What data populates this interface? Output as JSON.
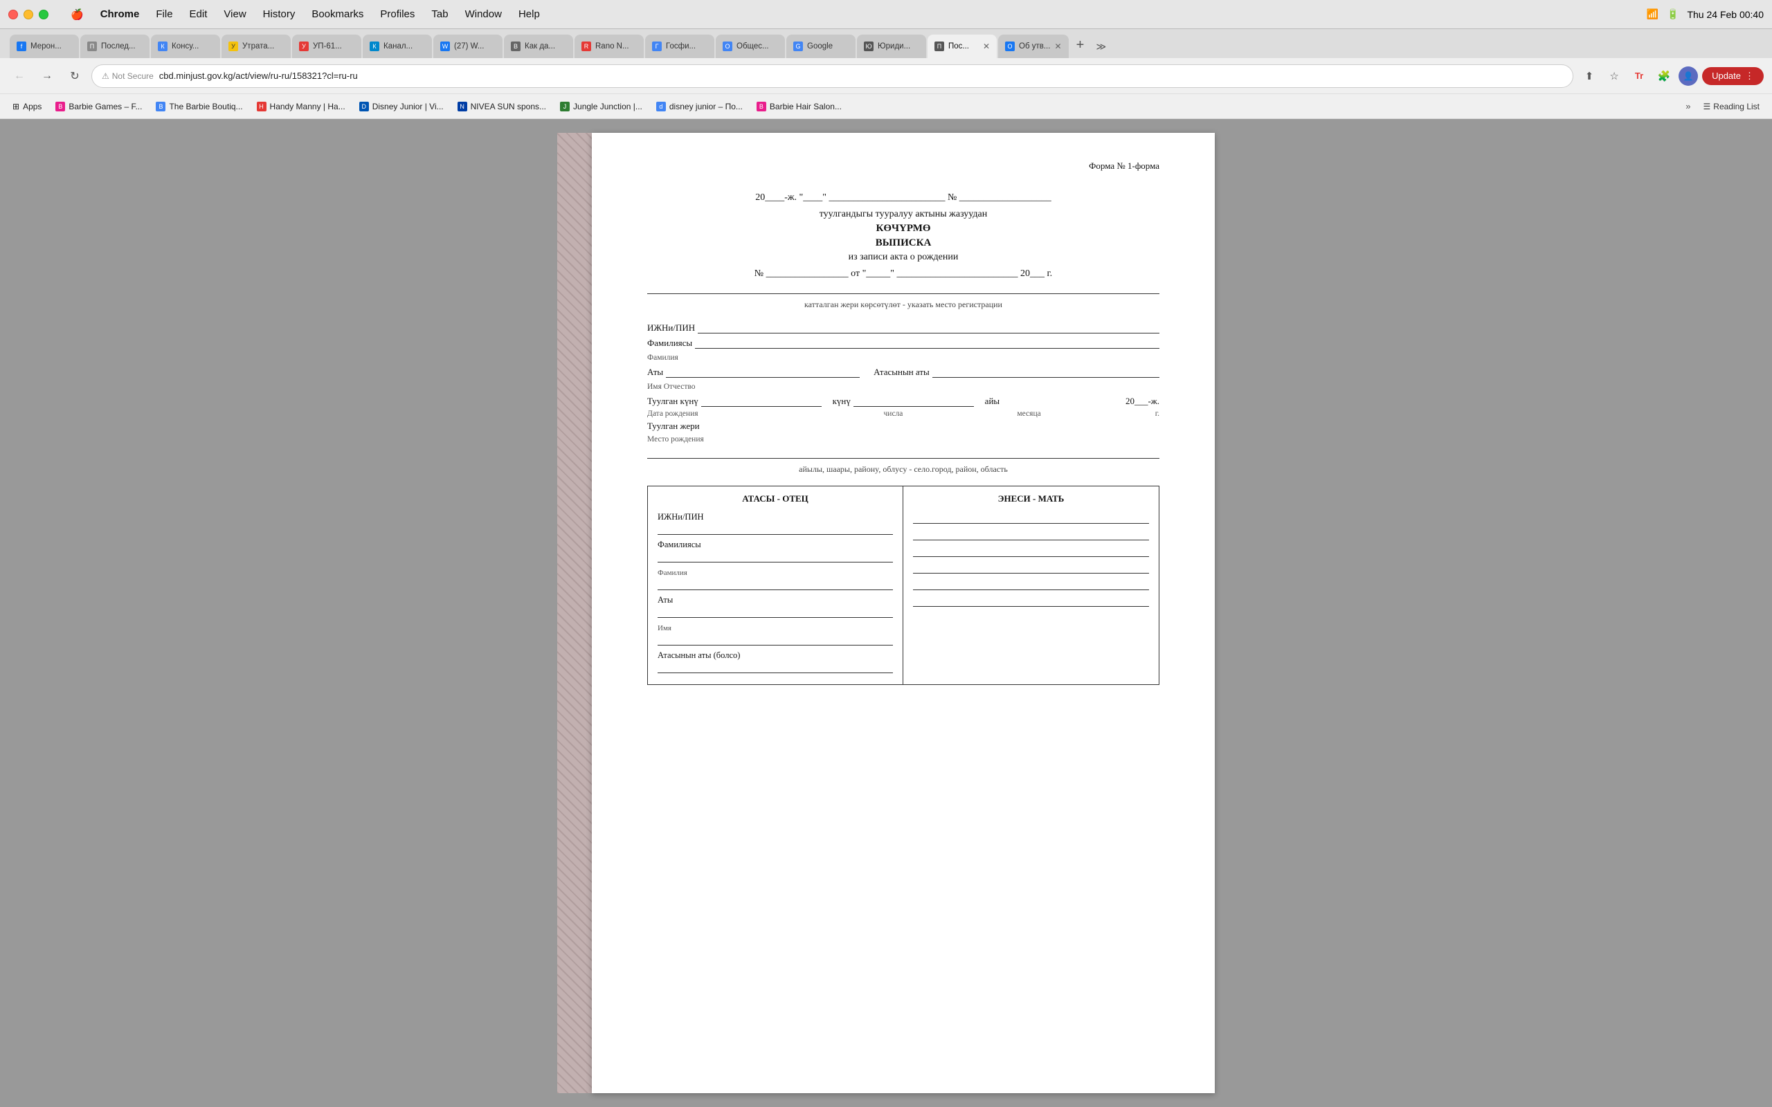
{
  "menubar": {
    "apple": "🍎",
    "items": [
      "Chrome",
      "File",
      "Edit",
      "View",
      "History",
      "Bookmarks",
      "Profiles",
      "Tab",
      "Window",
      "Help"
    ],
    "active_item": "Chrome",
    "time": "Thu 24 Feb  00:40"
  },
  "browser": {
    "tabs": [
      {
        "id": "t1",
        "label": "Мерон...",
        "favicon_color": "#1877f2",
        "favicon_letter": "f",
        "active": false
      },
      {
        "id": "t2",
        "label": "Послед...",
        "favicon_color": "#888",
        "favicon_letter": "П",
        "active": false
      },
      {
        "id": "t3",
        "label": "Консу...",
        "favicon_color": "#4285f4",
        "favicon_letter": "К",
        "active": false
      },
      {
        "id": "t4",
        "label": "Утрата...",
        "favicon_color": "#f4c20d",
        "favicon_letter": "У",
        "active": false
      },
      {
        "id": "t5",
        "label": "УП-61...",
        "favicon_color": "#e53935",
        "favicon_letter": "У",
        "active": false
      },
      {
        "id": "t6",
        "label": "Канал...",
        "favicon_color": "#0088cc",
        "favicon_letter": "К",
        "active": false
      },
      {
        "id": "t7",
        "label": "(27) W...",
        "favicon_color": "#1877f2",
        "favicon_letter": "W",
        "active": false
      },
      {
        "id": "t8",
        "label": "Как да...",
        "favicon_color": "#666",
        "favicon_letter": "B",
        "active": false
      },
      {
        "id": "t9",
        "label": "Rano N...",
        "favicon_color": "#e53935",
        "favicon_letter": "R",
        "active": false
      },
      {
        "id": "t10",
        "label": "Госфи...",
        "favicon_color": "#4285f4",
        "favicon_letter": "Г",
        "active": false
      },
      {
        "id": "t11",
        "label": "Общес...",
        "favicon_color": "#4285f4",
        "favicon_letter": "О",
        "active": false
      },
      {
        "id": "t12",
        "label": "Google",
        "favicon_color": "#4285f4",
        "favicon_letter": "G",
        "active": false
      },
      {
        "id": "t13",
        "label": "Юриди...",
        "favicon_color": "#555",
        "favicon_letter": "Ю",
        "active": false
      },
      {
        "id": "t14",
        "label": "Пос...",
        "favicon_color": "#555",
        "favicon_letter": "П",
        "active": true
      },
      {
        "id": "t15",
        "label": "Об утв...",
        "favicon_color": "#1877f2",
        "favicon_letter": "О",
        "active": false
      }
    ],
    "address_bar": {
      "not_secure": "Not Secure",
      "url": "cbd.minjust.gov.kg/act/view/ru-ru/158321?cl=ru-ru"
    },
    "bookmarks": [
      {
        "label": "Apps",
        "favicon": "⊞",
        "is_apps": true
      },
      {
        "label": "Barbie Games – F...",
        "favicon_color": "#e91e8c"
      },
      {
        "label": "The Barbie Boutiq...",
        "favicon_color": "#4285f4"
      },
      {
        "label": "Handy Manny | Ha...",
        "favicon_color": "#e53935"
      },
      {
        "label": "Disney Junior | Vi...",
        "favicon_color": "#0055b3"
      },
      {
        "label": "NIVEA SUN spons...",
        "favicon_color": "#003da5"
      },
      {
        "label": "Jungle Junction |...",
        "favicon_color": "#2e7d32"
      },
      {
        "label": "disney junior – По...",
        "favicon_color": "#4285f4"
      },
      {
        "label": "Barbie Hair Salon...",
        "favicon_color": "#e91e8c"
      }
    ],
    "reading_list": "Reading List"
  },
  "document": {
    "forma": "Форма № 1-форма",
    "date_line": "20____-ж. \"____\"  ________________________  №  ___________________",
    "title1": "туулгандыгы тууралуу актыны жазуудан",
    "title2": "КӨЧҮРМӨ",
    "title3": "ВЫПИСКА",
    "title4": "из записи акта о рождении",
    "from_line": "№  _________________  от \"_____\"  _________________________  20___ г.",
    "caption": "катталган жери көрсөтүлөт - указать место регистрации",
    "fields": {
      "izhn_label": "ИЖНи/ПИН",
      "familias_label": "Фамилиясы",
      "familia_label": "Фамилия",
      "aty_label": "Аты",
      "atasyn_aty_label": "Атасынын аты",
      "imya_otchestvo_label": "Имя Отчество",
      "tuulgan_kunu_label": "Туулган күнү",
      "kunu_label": "күнү",
      "aiy_label": "айы",
      "year_suffix": "20___-ж.",
      "data_rozhd_label": "Дата рождения",
      "chisla_label": "числа",
      "mesyaca_label": "месяца",
      "g_label": "г.",
      "tuulgan_zheri_label": "Туулган жери",
      "mesto_rozhd_label": "Место рождения",
      "location_caption": "айылы, шаары, районy, облусу - село.город, район, область",
      "father_header": "АТАСЫ - ОТЕЦ",
      "mother_header": "ЭНЕСИ - МАТЬ",
      "izhn_label2": "ИЖНи/ПИН",
      "familias_label2": "Фамилиясы",
      "familia_label2": "Фамилия",
      "aty_label2": "Аты",
      "imya_label": "Имя",
      "atas_aty_bolso": "Атасынын аты (болсо)"
    }
  }
}
